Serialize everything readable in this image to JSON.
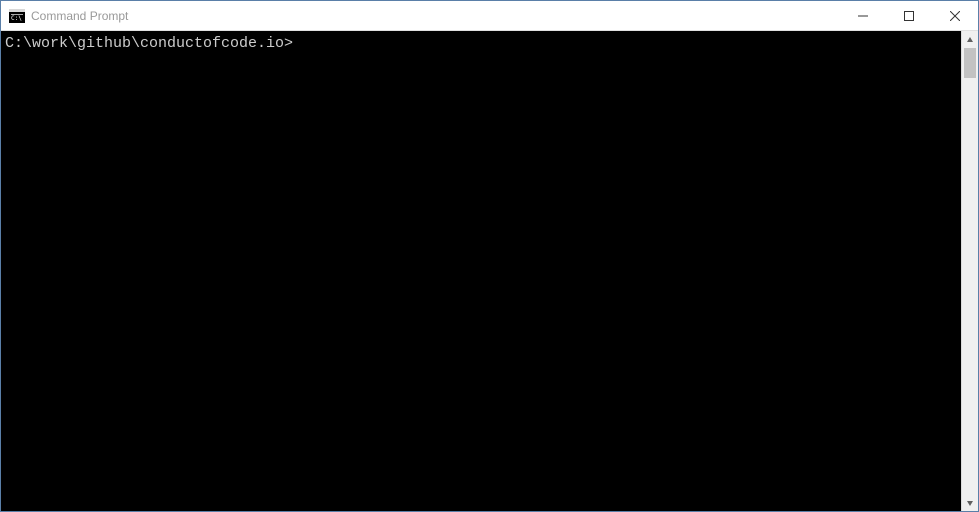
{
  "window": {
    "title": "Command Prompt"
  },
  "terminal": {
    "prompt": "C:\\work\\github\\conductofcode.io>"
  }
}
